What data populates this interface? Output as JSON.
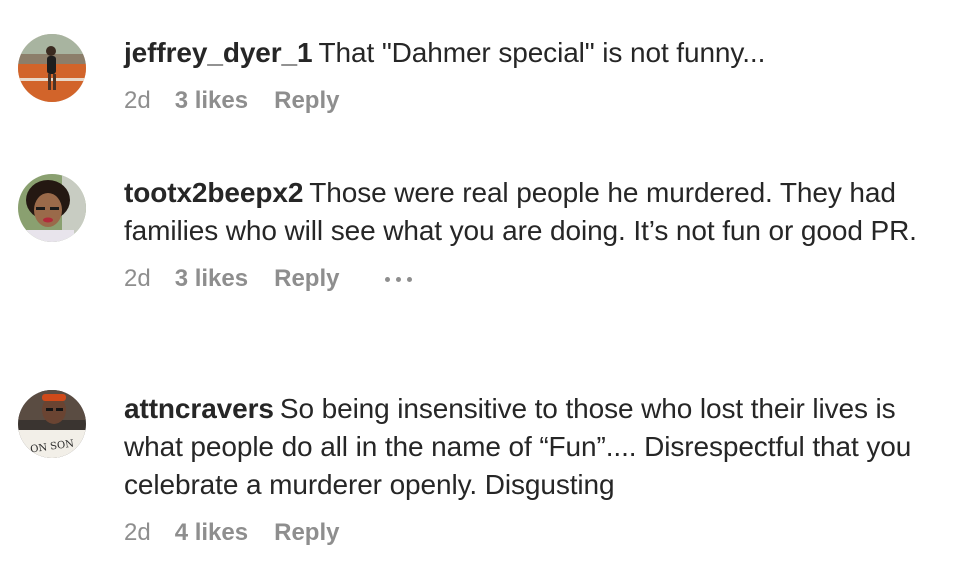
{
  "comments": [
    {
      "username": "jeffrey_dyer_1",
      "text": "That \"Dahmer special\" is not funny...",
      "time": "2d",
      "likes": "3 likes",
      "reply": "Reply",
      "avatar": "runner-photo-avatar"
    },
    {
      "username": "tootx2beepx2",
      "text": "Those were real people he murdered. They had families who will see what you are doing. It’s not fun or good PR.",
      "time": "2d",
      "likes": "3 likes",
      "reply": "Reply",
      "has_more_options": true,
      "avatar": "woman-portrait-avatar"
    },
    {
      "username": "attncravers",
      "text": "So being insensitive to those who lost their lives is what people do all in the name of “Fun”.... Disrespectful that you celebrate a murderer openly. Disgusting",
      "time": "2d",
      "likes": "4 likes",
      "reply": "Reply",
      "avatar": "man-with-sign-avatar",
      "avatar_sign_text": "ON SON"
    }
  ],
  "colors": {
    "text": "#262626",
    "meta": "#8e8e8e",
    "background": "#ffffff"
  }
}
